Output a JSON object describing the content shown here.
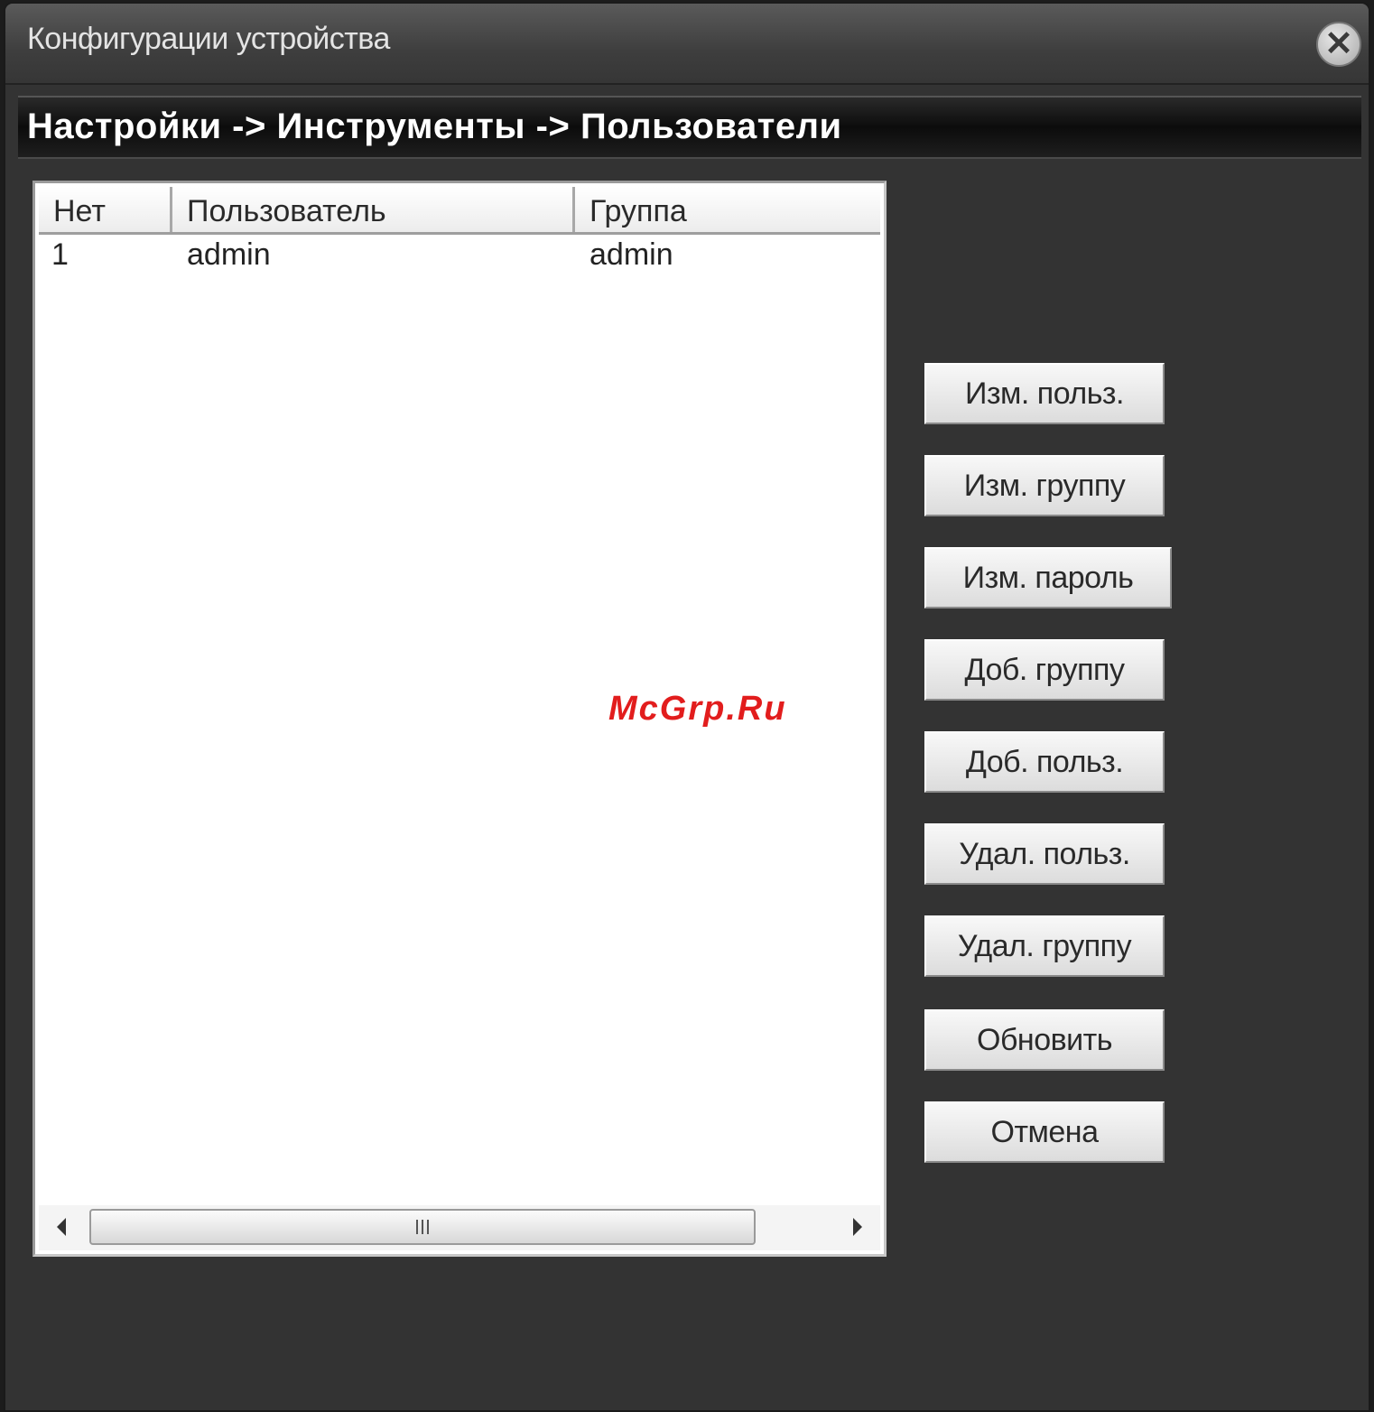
{
  "window": {
    "title": "Конфигурации устройства",
    "close_icon": "close-icon"
  },
  "breadcrumb": "Настройки -> Инструменты -> Пользователи",
  "table": {
    "columns": [
      "Нет",
      "Пользователь",
      "Группа"
    ],
    "rows": [
      [
        "1",
        "admin",
        "admin"
      ]
    ]
  },
  "buttons": [
    "Изм. польз.",
    "Изм. группу",
    "Изм. пароль",
    "Доб. группу",
    "Доб. польз.",
    "Удал. польз.",
    "Удал. группу",
    "Обновить",
    "Отмена"
  ],
  "watermark": "McGrp.Ru",
  "colors": {
    "background": "#333333",
    "watermark": "#e21d1d"
  }
}
